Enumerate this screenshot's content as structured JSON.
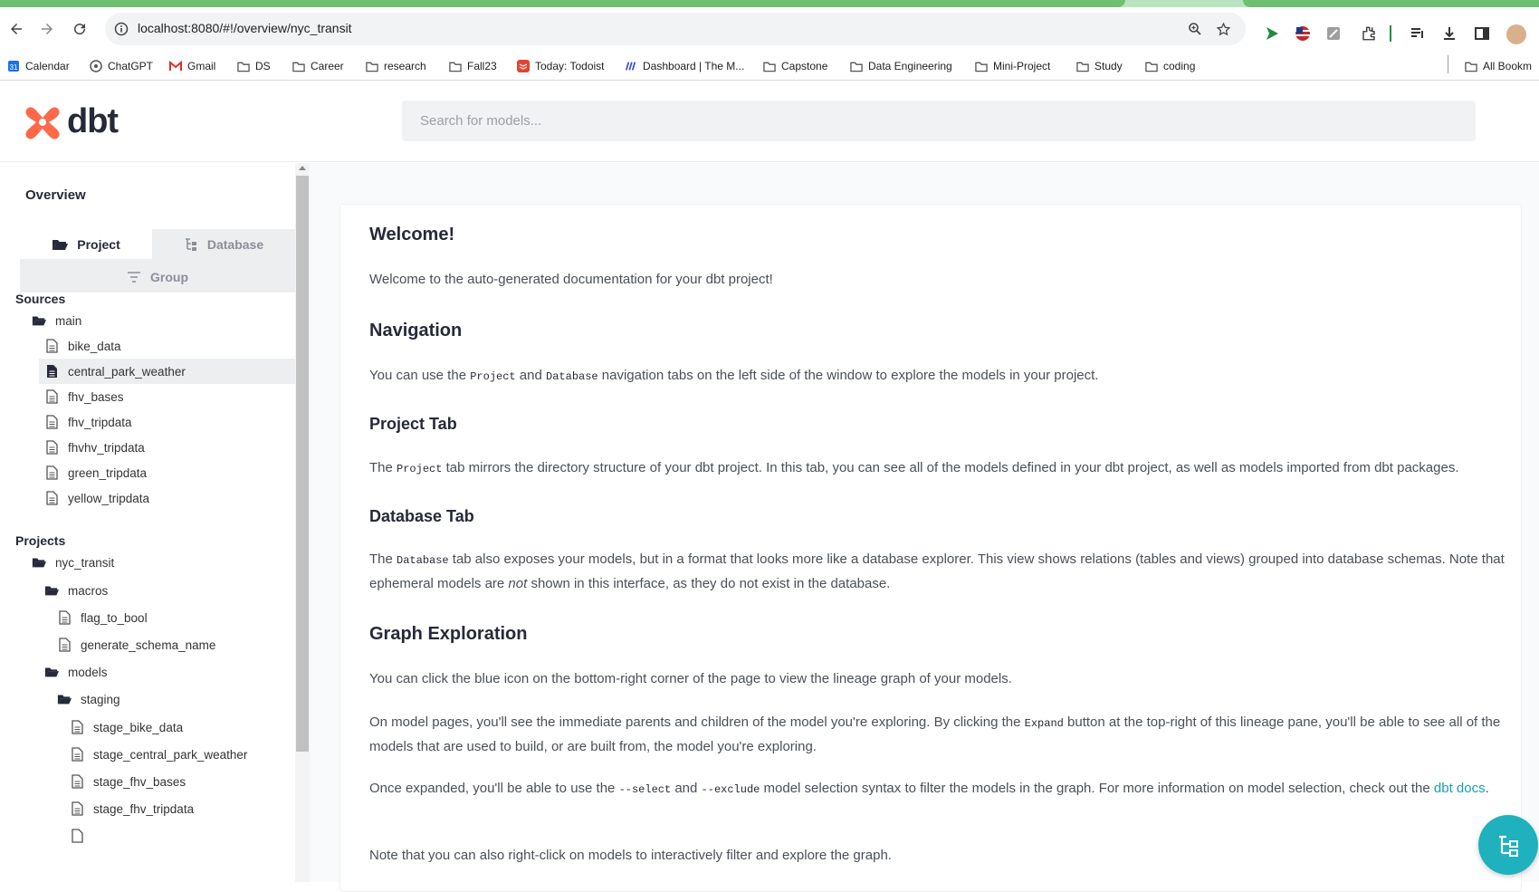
{
  "browser": {
    "url": "localhost:8080/#!/overview/nyc_transit",
    "bookmarks": [
      {
        "label": "Calendar",
        "icon": "calendar-icon"
      },
      {
        "label": "ChatGPT",
        "icon": "chatgpt-icon"
      },
      {
        "label": "Gmail",
        "icon": "gmail-icon"
      },
      {
        "label": "DS",
        "icon": "folder-icon"
      },
      {
        "label": "Career",
        "icon": "folder-icon"
      },
      {
        "label": "research",
        "icon": "folder-icon"
      },
      {
        "label": "Fall23",
        "icon": "folder-icon"
      },
      {
        "label": "Today: Todoist",
        "icon": "todoist-icon"
      },
      {
        "label": "Dashboard | The M...",
        "icon": "dashboard-icon"
      },
      {
        "label": "Capstone",
        "icon": "folder-icon"
      },
      {
        "label": "Data Engineering",
        "icon": "folder-icon"
      },
      {
        "label": "Mini-Project",
        "icon": "folder-icon"
      },
      {
        "label": "Study",
        "icon": "folder-icon"
      },
      {
        "label": "coding",
        "icon": "folder-icon"
      },
      {
        "label": "All Bookm",
        "icon": "folder-icon"
      }
    ]
  },
  "app": {
    "logo_text": "dbt",
    "search_placeholder": "Search for models..."
  },
  "sidebar": {
    "title": "Overview",
    "tabs": {
      "project": "Project",
      "database": "Database",
      "group": "Group"
    },
    "sources_heading": "Sources",
    "sources_folder": "main",
    "sources": [
      "bike_data",
      "central_park_weather",
      "fhv_bases",
      "fhv_tripdata",
      "fhvhv_tripdata",
      "green_tripdata",
      "yellow_tripdata"
    ],
    "selected_source": "central_park_weather",
    "projects_heading": "Projects",
    "project_name": "nyc_transit",
    "macros_folder": "macros",
    "macros": [
      "flag_to_bool",
      "generate_schema_name"
    ],
    "models_folder": "models",
    "staging_folder": "staging",
    "staging_models": [
      "stage_bike_data",
      "stage_central_park_weather",
      "stage_fhv_bases",
      "stage_fhv_tripdata"
    ]
  },
  "main": {
    "welcome_title": "Welcome!",
    "welcome_text": "Welcome to the auto-generated documentation for your dbt project!",
    "nav_title": "Navigation",
    "nav_text_1": "You can use the ",
    "nav_code_project": "Project",
    "nav_text_2": " and ",
    "nav_code_database": "Database",
    "nav_text_3": " navigation tabs on the left side of the window to explore the models in your project.",
    "project_tab_title": "Project Tab",
    "project_tab_text_1": "The ",
    "project_tab_code": "Project",
    "project_tab_text_2": " tab mirrors the directory structure of your dbt project. In this tab, you can see all of the models defined in your dbt project, as well as models imported from dbt packages.",
    "database_tab_title": "Database Tab",
    "database_tab_text_1": "The ",
    "database_tab_code": "Database",
    "database_tab_text_2": " tab also exposes your models, but in a format that looks more like a database explorer. This view shows relations (tables and views) grouped into database schemas. Note that ephemeral models are ",
    "database_tab_em": "not",
    "database_tab_text_3": " shown in this interface, as they do not exist in the database.",
    "graph_title": "Graph Exploration",
    "graph_p1": "You can click the blue icon on the bottom-right corner of the page to view the lineage graph of your models.",
    "graph_p2_a": "On model pages, you'll see the immediate parents and children of the model you're exploring. By clicking the ",
    "graph_p2_code": "Expand",
    "graph_p2_b": " button at the top-right of this lineage pane, you'll be able to see all of the models that are used to build, or are built from, the model you're exploring.",
    "graph_p3_a": "Once expanded, you'll be able to use the ",
    "graph_p3_code1": "--select",
    "graph_p3_b": " and ",
    "graph_p3_code2": "--exclude",
    "graph_p3_c": " model selection syntax to filter the models in the graph. For more information on model selection, check out the ",
    "graph_p3_link": "dbt docs",
    "graph_p3_d": ".",
    "graph_p4": "Note that you can also right-click on models to interactively filter and explore the graph."
  },
  "colors": {
    "accent": "#1fb1bd",
    "link": "#17a0b4",
    "dbt_orange": "#ff694a"
  }
}
